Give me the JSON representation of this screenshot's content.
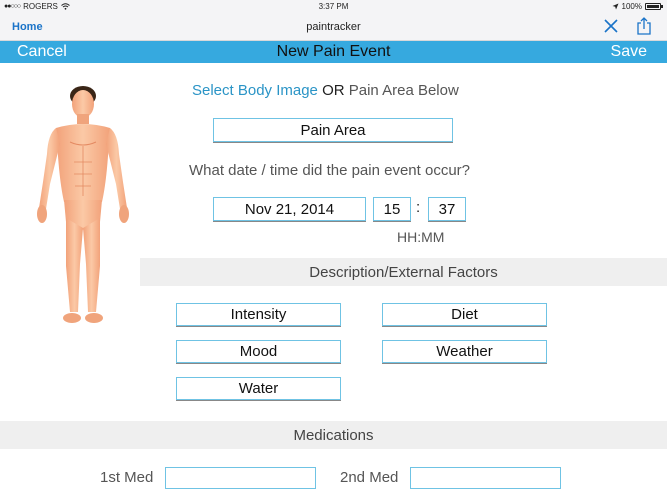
{
  "status_bar": {
    "carrier": "ROGERS",
    "time": "3:37 PM",
    "battery": "100%"
  },
  "browser": {
    "home_label": "Home",
    "title": "paintracker"
  },
  "nav": {
    "cancel_label": "Cancel",
    "title": "New Pain Event",
    "save_label": "Save"
  },
  "selection": {
    "select_body_image": "Select Body Image",
    "or_label": "OR",
    "pain_area_below": "Pain Area Below",
    "pain_area_button": "Pain Area"
  },
  "datetime": {
    "question": "What date / time did the pain event occur?",
    "date_value": "Nov 21, 2014",
    "hour_value": "15",
    "separator": ":",
    "minute_value": "37",
    "format_hint": "HH:MM"
  },
  "factors": {
    "header": "Description/External Factors",
    "buttons": [
      "Intensity",
      "Diet",
      "Mood",
      "Weather",
      "Water"
    ]
  },
  "medications": {
    "header": "Medications",
    "first_label": "1st Med",
    "second_label": "2nd Med"
  },
  "colors": {
    "accent": "#36a9df",
    "link": "#2a94c6",
    "section_bg": "#efefef"
  }
}
